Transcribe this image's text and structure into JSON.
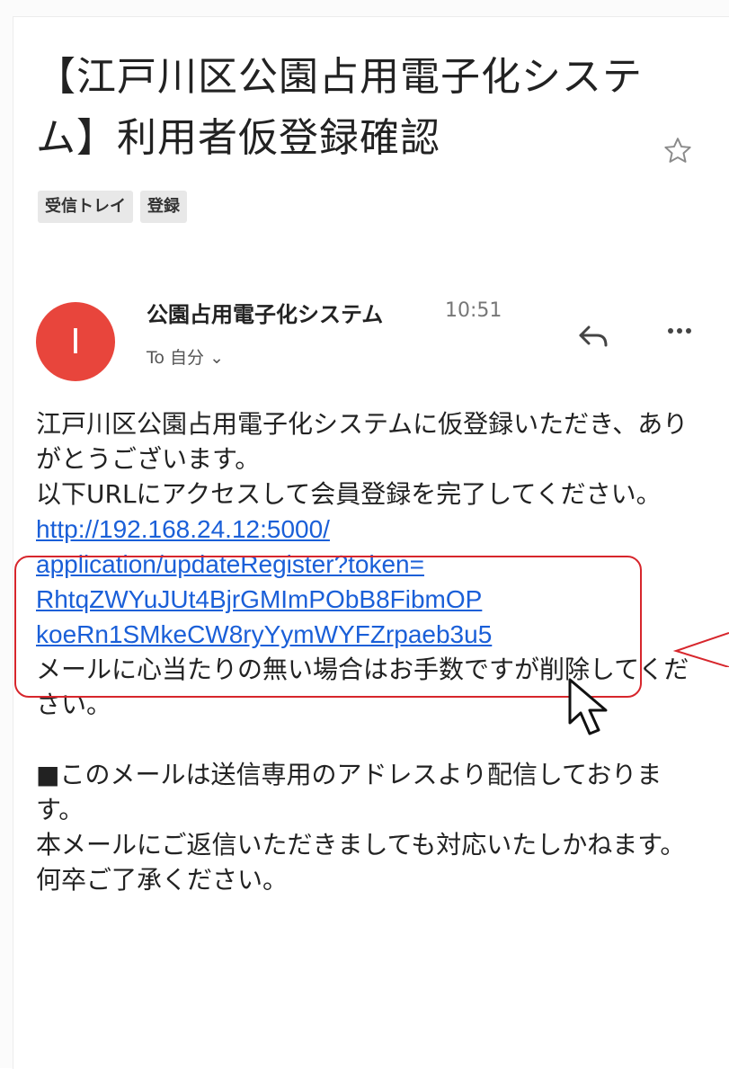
{
  "subject": "【江戸川区公園占用電子化システム】利用者仮登録確認",
  "labels": [
    "受信トレイ",
    "登録"
  ],
  "sender": {
    "avatar_initial": "I",
    "avatar_color": "#e8453c",
    "name": "公園占用電子化システム",
    "time": "10:51",
    "to": "To 自分 ⌄"
  },
  "icons": {
    "star": "star-outline-icon",
    "reply": "reply-icon",
    "more": "more-horizontal-icon",
    "cursor": "mouse-cursor-icon"
  },
  "body": {
    "line1": "江戸川区公園占用電子化システムに仮登録いただき、ありがとうございます。",
    "line2": "以下URLにアクセスして会員登録を完了してください。",
    "url_line1": "http://192.168.24.12:5000/",
    "url_line2": "application/updateRegister?token=",
    "url_line3": "RhtqZWYuJUt4BjrGMImPObB8FibmOP",
    "url_line4": "koeRn1SMkeCW8ryYymWYFZrpaeb3u5",
    "line3": "メールに心当たりの無い場合はお手数ですが削除してください。",
    "line4": "■このメールは送信専用のアドレスより配信しております。",
    "line5": "本メールにご返信いただきましても対応いたしかねます。",
    "line6": "何卒ご了承ください。"
  },
  "colors": {
    "link": "#1a5fd8",
    "highlight": "#d7262c"
  }
}
